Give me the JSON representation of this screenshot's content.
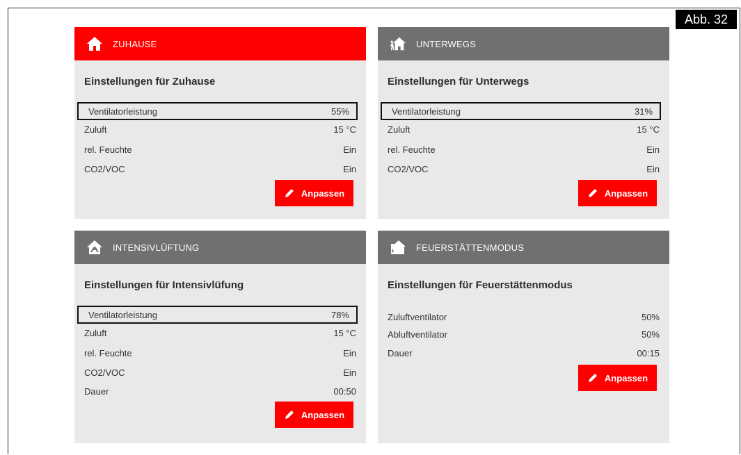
{
  "figure_label": "Abb. 32",
  "edit_label": "Anpassen",
  "colors": {
    "active": "#ff0000",
    "inactive": "#707070",
    "panel": "#e9e9e9"
  },
  "cards": [
    {
      "title": "ZUHAUSE",
      "icon": "home-icon",
      "subtitle": "Einstellungen für Zuhause",
      "rows": [
        {
          "label": "Ventilatorleistung",
          "value": "55%"
        },
        {
          "label": "Zuluft",
          "value": "15 °C"
        },
        {
          "label": "rel. Feuchte",
          "value": "Ein"
        },
        {
          "label": "CO2/VOC",
          "value": "Ein"
        }
      ]
    },
    {
      "title": "UNTERWEGS",
      "icon": "away-home-icon",
      "subtitle": "Einstellungen für Unterwegs",
      "rows": [
        {
          "label": "Ventilatorleistung",
          "value": "31%"
        },
        {
          "label": "Zuluft",
          "value": "15 °C"
        },
        {
          "label": "rel. Feuchte",
          "value": "Ein"
        },
        {
          "label": "CO2/VOC",
          "value": "Ein"
        }
      ]
    },
    {
      "title": "INTENSIVLÜFTUNG",
      "icon": "intensive-ventilation-icon",
      "subtitle": "Einstellungen für Intensivlüfung",
      "rows": [
        {
          "label": "Ventilatorleistung",
          "value": "78%"
        },
        {
          "label": "Zuluft",
          "value": "15 °C"
        },
        {
          "label": "rel. Feuchte",
          "value": "Ein"
        },
        {
          "label": "CO2/VOC",
          "value": "Ein"
        },
        {
          "label": "Dauer",
          "value": "00:50"
        }
      ]
    },
    {
      "title": "FEUERSTÄTTENMODUS",
      "icon": "fireplace-icon",
      "subtitle": "Einstellungen für Feuerstättenmodus",
      "rows": [
        {
          "label": "Zuluftventilator",
          "value": "50%"
        },
        {
          "label": "Abluftventilator",
          "value": "50%"
        },
        {
          "label": "Dauer",
          "value": "00:15"
        }
      ]
    }
  ]
}
